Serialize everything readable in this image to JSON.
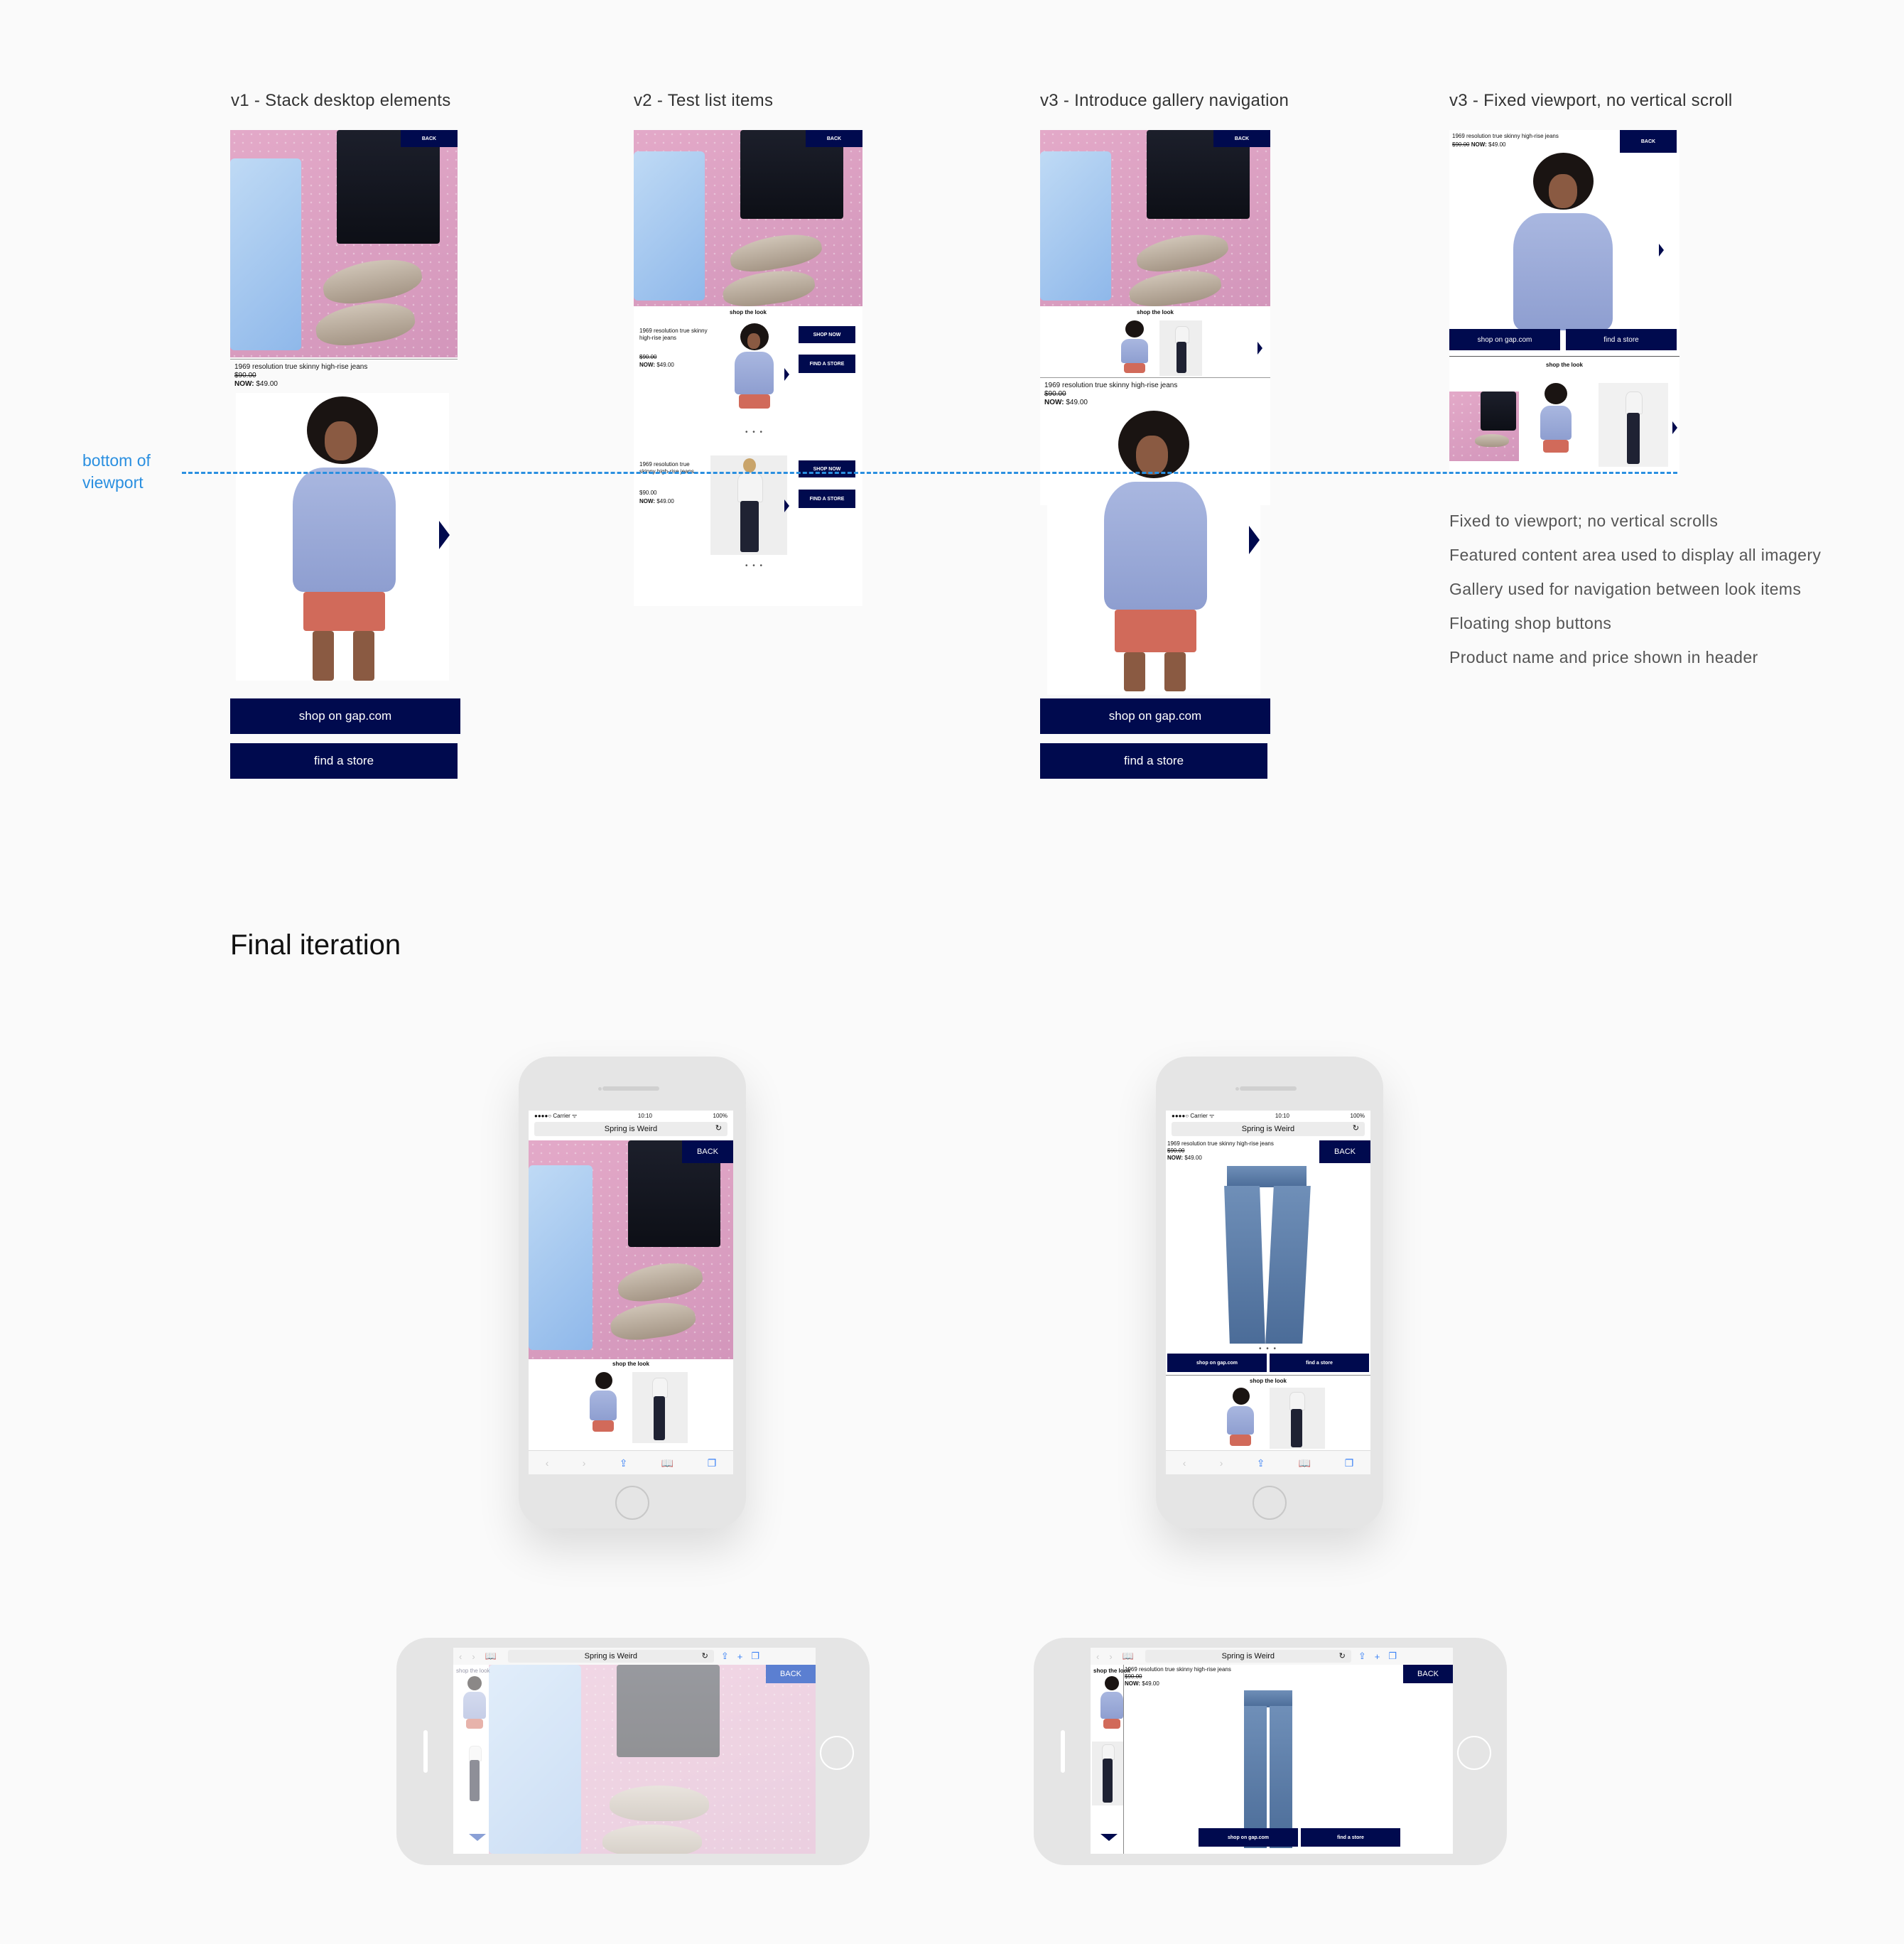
{
  "columns": {
    "v1": {
      "title": "v1 - Stack desktop elements"
    },
    "v2": {
      "title": "v2 - Test list items"
    },
    "v3a": {
      "title": "v3 - Introduce gallery navigation"
    },
    "v3b": {
      "title": "v3 - Fixed viewport, no vertical scroll"
    }
  },
  "viewport_label": "bottom of viewport",
  "product": {
    "name": "1969 resolution true skinny high-rise jeans",
    "name_short": "1969 resolution true skinny high-rise jeans",
    "old_price": "$90.00",
    "now_label": "NOW:",
    "now_price": "$49.00",
    "plain_price": "$90.00"
  },
  "labels": {
    "back": "BACK",
    "back_mixed": "BACK",
    "shop_the_look": "shop the look",
    "shop_on_gap": "shop on gap.com",
    "find_a_store": "find a store",
    "shop_now": "SHOP NOW",
    "find_a_store_caps": "FIND A STORE",
    "dots": "• • •"
  },
  "notes": [
    "Fixed to viewport; no vertical scrolls",
    "Featured content area used to display all imagery",
    "Gallery used for navigation between look items",
    "Floating shop buttons",
    "Product name and price shown in header"
  ],
  "final": {
    "heading": "Final iteration",
    "status_carrier": "●●●●○ Carrier ᯤ",
    "status_time": "10:10",
    "status_battery": "100%",
    "page_title": "Spring is Weird",
    "reload_icon": "↻"
  },
  "colors": {
    "navy": "#000a4e",
    "dashed_line": "#2a8fe0",
    "label_blue": "#2a8fe0"
  }
}
